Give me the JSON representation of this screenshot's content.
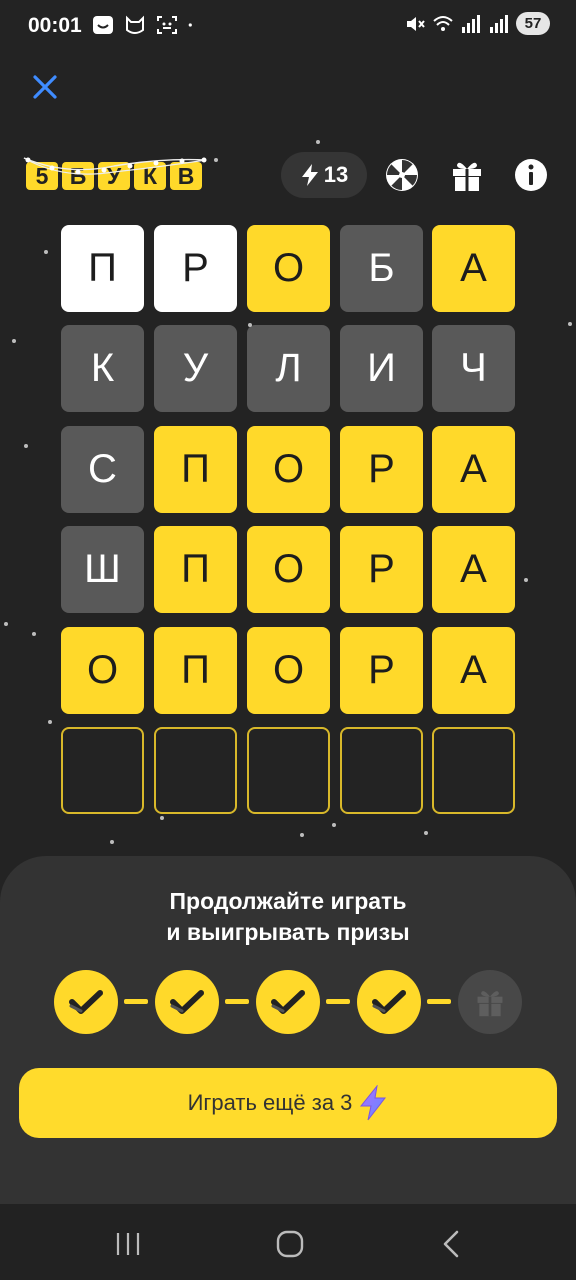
{
  "status_bar": {
    "time": "00:01",
    "battery": "57",
    "icons_left": [
      "smile-app-icon",
      "cat-app-icon",
      "face-scan-icon",
      "dot-icon"
    ],
    "icons_right": [
      "mute-icon",
      "wifi-icon",
      "signal-icon",
      "signal-icon"
    ]
  },
  "header": {
    "logo_letters": [
      "5",
      "Б",
      "У",
      "К",
      "В"
    ],
    "energy_count": "13",
    "icons": [
      "wheel-icon",
      "gift-icon",
      "info-icon"
    ]
  },
  "board": {
    "rows": [
      {
        "letters": [
          "П",
          "Р",
          "О",
          "Б",
          "А"
        ],
        "states": [
          "white",
          "white",
          "yellow",
          "gray",
          "yellow"
        ]
      },
      {
        "letters": [
          "К",
          "У",
          "Л",
          "И",
          "Ч"
        ],
        "states": [
          "gray",
          "gray",
          "gray",
          "gray",
          "gray"
        ]
      },
      {
        "letters": [
          "С",
          "П",
          "О",
          "Р",
          "А"
        ],
        "states": [
          "gray",
          "yellow",
          "yellow",
          "yellow",
          "yellow"
        ]
      },
      {
        "letters": [
          "Ш",
          "П",
          "О",
          "Р",
          "А"
        ],
        "states": [
          "gray",
          "yellow",
          "yellow",
          "yellow",
          "yellow"
        ]
      },
      {
        "letters": [
          "О",
          "П",
          "О",
          "Р",
          "А"
        ],
        "states": [
          "yellow",
          "yellow",
          "yellow",
          "yellow",
          "yellow"
        ]
      },
      {
        "letters": [
          "",
          "",
          "",
          "",
          ""
        ],
        "states": [
          "empty",
          "empty",
          "empty",
          "empty",
          "empty"
        ]
      }
    ]
  },
  "sheet": {
    "title_line1": "Продолжайте играть",
    "title_line2": "и выигрывать призы",
    "progress_steps": [
      "done",
      "done",
      "done",
      "done",
      "gift"
    ],
    "play_button_label": "Играть ещё за 3"
  },
  "colors": {
    "background": "#232323",
    "yellow": "#ffd92a",
    "gray_tile": "#595959",
    "sheet": "#333333"
  }
}
